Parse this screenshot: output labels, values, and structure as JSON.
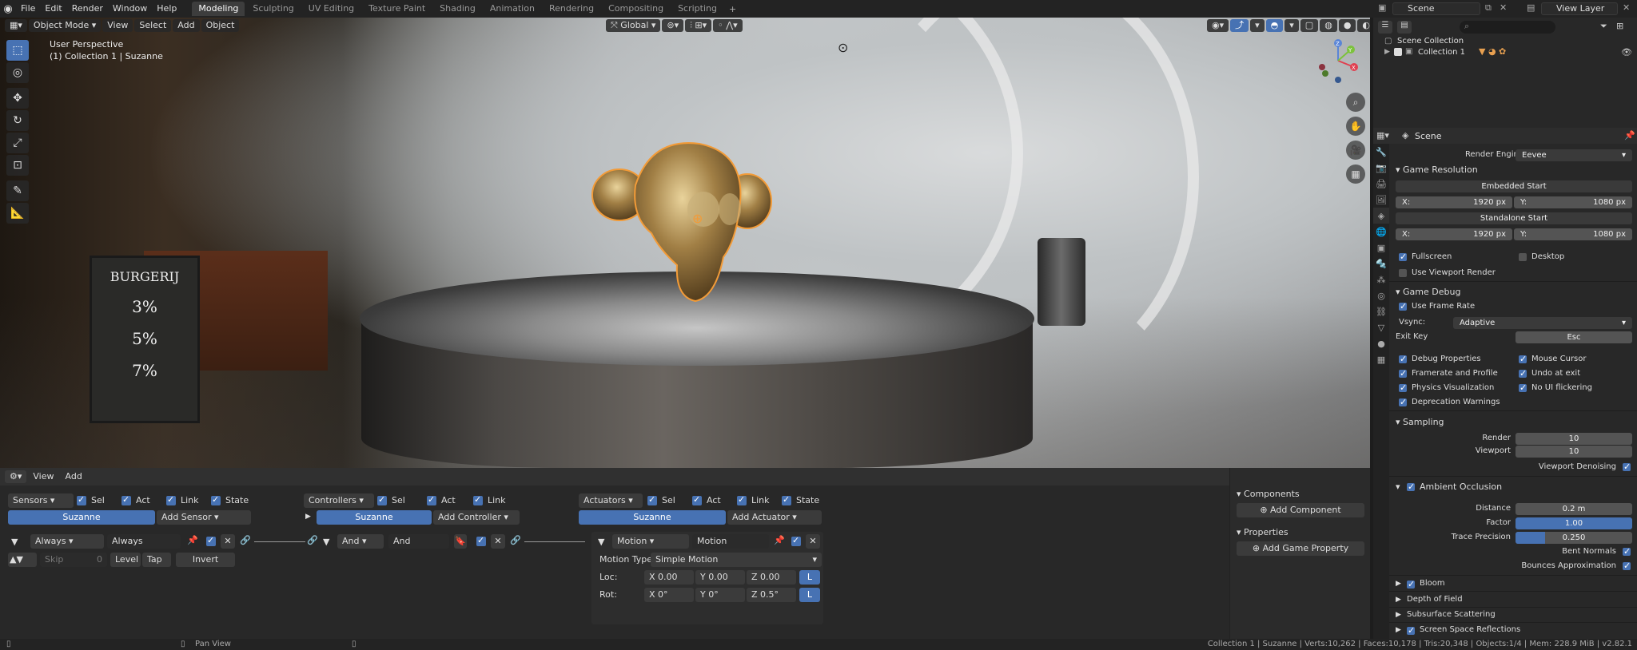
{
  "topbar": {
    "menus": [
      "File",
      "Edit",
      "Render",
      "Window",
      "Help"
    ],
    "workspaces": [
      "Modeling",
      "Sculpting",
      "UV Editing",
      "Texture Paint",
      "Shading",
      "Animation",
      "Rendering",
      "Compositing",
      "Scripting"
    ],
    "active_workspace": "Modeling",
    "add_workspace": "+",
    "scene": "Scene",
    "view_layer": "View Layer"
  },
  "viewport": {
    "mode": "Object Mode",
    "menus": [
      "View",
      "Select",
      "Add",
      "Object"
    ],
    "transform_orientation": "Global",
    "info_line1": "User Perspective",
    "info_line2": "(1) Collection 1 | Suzanne",
    "gizmo_axes": [
      "Z",
      "Y",
      "X"
    ]
  },
  "scene_photo": {
    "board_title": "BURGERIJ",
    "board_lines": [
      "3%",
      "5%",
      "7%"
    ]
  },
  "logic_editor": {
    "menus": [
      "View",
      "Add"
    ],
    "sensors": {
      "label": "Sensors",
      "checks": [
        "Sel",
        "Act",
        "Link",
        "State"
      ],
      "object": "Suzanne",
      "add": "Add Sensor",
      "brick_type": "Always",
      "brick_name": "Always",
      "skip_label": "Skip",
      "skip_value": "0",
      "level": "Level",
      "tap": "Tap",
      "invert": "Invert"
    },
    "controllers": {
      "label": "Controllers",
      "checks": [
        "Sel",
        "Act",
        "Link"
      ],
      "object": "Suzanne",
      "add": "Add Controller",
      "brick_type": "And",
      "brick_name": "And"
    },
    "actuators": {
      "label": "Actuators",
      "checks": [
        "Sel",
        "Act",
        "Link",
        "State"
      ],
      "object": "Suzanne",
      "add": "Add Actuator",
      "brick_type": "Motion",
      "brick_name": "Motion",
      "motion_type_label": "Motion Type:",
      "motion_type": "Simple Motion",
      "loc_label": "Loc:",
      "loc": [
        "X  0.00",
        "Y  0.00",
        "Z  0.00"
      ],
      "rot_label": "Rot:",
      "rot": [
        "X  0°",
        "Y  0°",
        "Z  0.5°"
      ],
      "local": "L"
    },
    "side_panel": {
      "components": "Components",
      "add_component": "Add Component",
      "properties": "Properties",
      "add_property": "Add Game Property"
    }
  },
  "statusbar": {
    "hint": "Pan View",
    "stats": "Collection 1 | Suzanne | Verts:10,262 | Faces:10,178 | Tris:20,348 | Objects:1/4 | Mem: 228.9 MiB | v2.82.1"
  },
  "outliner": {
    "root": "Scene Collection",
    "child": "Collection 1"
  },
  "properties": {
    "context": "Scene",
    "render_engine_label": "Render Engine",
    "render_engine": "Eevee",
    "game_resolution": "Game Resolution",
    "embedded_start": "Embedded Start",
    "standalone_start": "Standalone Start",
    "res_x_label": "X:",
    "res_x": "1920 px",
    "res_y_label": "Y:",
    "res_y": "1080 px",
    "fullscreen": "Fullscreen",
    "desktop": "Desktop",
    "use_viewport_render": "Use Viewport Render",
    "game_debug": "Game Debug",
    "use_frame_rate": "Use Frame Rate",
    "vsync_label": "Vsync:",
    "vsync": "Adaptive",
    "exit_key_label": "Exit Key",
    "exit_key": "Esc",
    "debug_properties": "Debug Properties",
    "mouse_cursor": "Mouse Cursor",
    "framerate_profile": "Framerate and Profile",
    "undo_at_exit": "Undo at exit",
    "physics_visualization": "Physics Visualization",
    "no_ui_flickering": "No UI flickering",
    "deprecation_warnings": "Deprecation Warnings",
    "sampling": "Sampling",
    "render_label": "Render",
    "render_samples": "10",
    "viewport_label": "Viewport",
    "viewport_samples": "10",
    "viewport_denoising": "Viewport Denoising",
    "ambient_occlusion": "Ambient Occlusion",
    "distance_label": "Distance",
    "distance": "0.2 m",
    "factor_label": "Factor",
    "factor": "1.00",
    "trace_precision_label": "Trace Precision",
    "trace_precision": "0.250",
    "trace_precision_fill": 0.25,
    "bent_normals": "Bent Normals",
    "bounces_approximation": "Bounces Approximation",
    "bloom": "Bloom",
    "depth_of_field": "Depth of Field",
    "subsurface_scattering": "Subsurface Scattering",
    "screen_space_reflections": "Screen Space Reflections"
  },
  "colors": {
    "accent": "#4772b3",
    "selection_outline": "#f29b38",
    "panel": "#282828"
  }
}
